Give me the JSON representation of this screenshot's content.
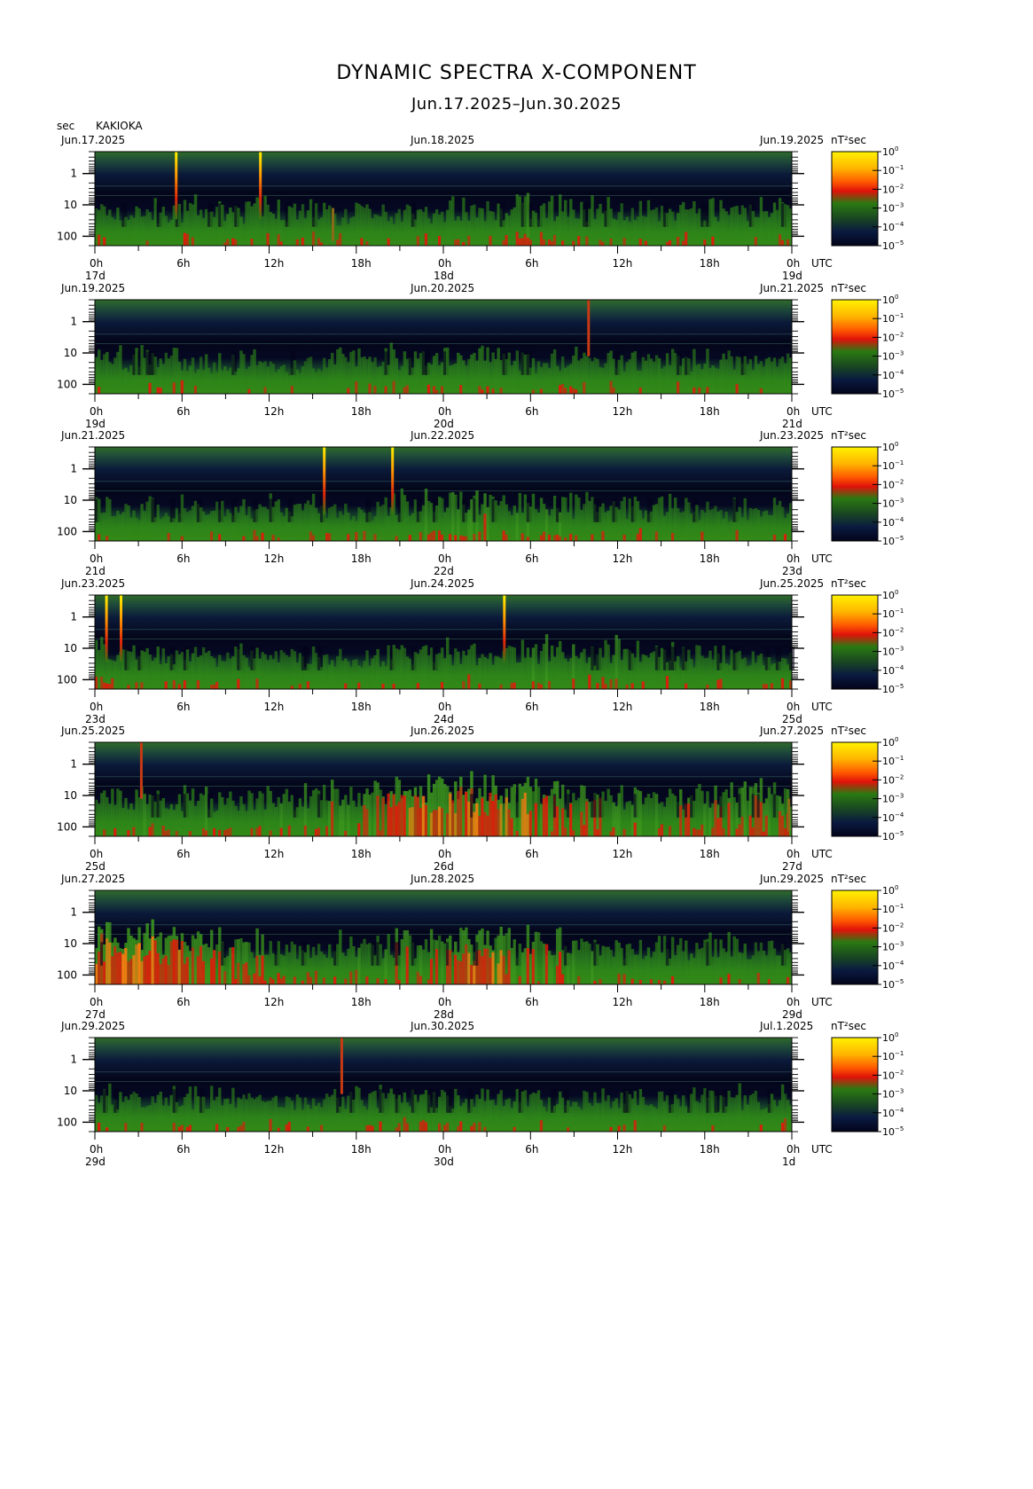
{
  "title": "DYNAMIC SPECTRA X-COMPONENT",
  "subtitle": "Jun.17.2025–Jun.30.2025",
  "y_unit": "sec",
  "station": "KAKIOKA",
  "colorbar_unit": "nT²sec",
  "time_zone": "UTC",
  "colors": {
    "background": "#050718",
    "low": "#0a1238",
    "mid": "#1c7a1c",
    "high": "#e01a0a",
    "peak": "#ffe400"
  },
  "chart_data": {
    "type": "heatmap",
    "title": "DYNAMIC SPECTRA X-COMPONENT",
    "subtitle": "Jun.17.2025–Jun.30.2025",
    "ylabel": "sec",
    "y_scale": "log",
    "y_ticks": [
      "1",
      "10",
      "100"
    ],
    "x_ticks": [
      "0h",
      "6h",
      "12h",
      "18h",
      "0h",
      "6h",
      "12h",
      "18h",
      "0h"
    ],
    "colorbar": {
      "label": "nT²sec",
      "scale": "log",
      "tick_mantissa": [
        "10",
        "10",
        "10",
        "10",
        "10",
        "10"
      ],
      "tick_exponents": [
        "0",
        "−1",
        "−2",
        "−3",
        "−4",
        "−5"
      ],
      "colors_top_to_bottom": [
        "#ffe000",
        "#ff8a00",
        "#e81b0a",
        "#2a7a12",
        "#0f2a4a",
        "#04051a"
      ]
    },
    "panels": [
      {
        "start_date": "Jun.17.2025",
        "mid_date": "Jun.18.2025",
        "end_date": "Jun.19.2025",
        "day_labels": [
          "17d",
          "18d",
          "19d"
        ],
        "activity": [
          0.45,
          0.5,
          0.55,
          0.5,
          0.4,
          0.45,
          0.5,
          0.6,
          0.55,
          0.45,
          0.5,
          0.55
        ],
        "spikes": [
          {
            "hour": 5.6,
            "strength": "strong"
          },
          {
            "hour": 11.4,
            "strength": "strong"
          },
          {
            "hour": 16.4,
            "strength": "weak"
          }
        ]
      },
      {
        "start_date": "Jun.19.2025",
        "mid_date": "Jun.20.2025",
        "end_date": "Jun.21.2025",
        "day_labels": [
          "19d",
          "20d",
          "21d"
        ],
        "activity": [
          0.5,
          0.45,
          0.4,
          0.3,
          0.45,
          0.5,
          0.55,
          0.45,
          0.45,
          0.5,
          0.45,
          0.4
        ],
        "spikes": [
          {
            "hour": 34.0,
            "strength": "medium"
          }
        ]
      },
      {
        "start_date": "Jun.21.2025",
        "mid_date": "Jun.22.2025",
        "end_date": "Jun.23.2025",
        "day_labels": [
          "21d",
          "22d",
          "23d"
        ],
        "activity": [
          0.45,
          0.4,
          0.4,
          0.45,
          0.35,
          0.6,
          0.65,
          0.6,
          0.5,
          0.45,
          0.35,
          0.4
        ],
        "spikes": [
          {
            "hour": 15.8,
            "strength": "strong"
          },
          {
            "hour": 20.5,
            "strength": "strong"
          }
        ]
      },
      {
        "start_date": "Jun.23.2025",
        "mid_date": "Jun.24.2025",
        "end_date": "Jun.25.2025",
        "day_labels": [
          "23d",
          "24d",
          "25d"
        ],
        "activity": [
          0.55,
          0.5,
          0.45,
          0.35,
          0.45,
          0.5,
          0.55,
          0.6,
          0.6,
          0.55,
          0.45,
          0.4
        ],
        "spikes": [
          {
            "hour": 0.8,
            "strength": "strong"
          },
          {
            "hour": 1.8,
            "strength": "strong"
          },
          {
            "hour": 28.2,
            "strength": "strong"
          }
        ]
      },
      {
        "start_date": "Jun.25.2025",
        "mid_date": "Jun.26.2025",
        "end_date": "Jun.27.2025",
        "day_labels": [
          "25d",
          "26d",
          "27d"
        ],
        "activity": [
          0.6,
          0.6,
          0.55,
          0.6,
          0.7,
          0.9,
          0.95,
          0.8,
          0.7,
          0.65,
          0.7,
          0.75
        ],
        "spikes": [
          {
            "hour": 3.2,
            "strength": "medium"
          },
          {
            "hour": 47.8,
            "strength": "weak"
          }
        ]
      },
      {
        "start_date": "Jun.27.2025",
        "mid_date": "Jun.28.2025",
        "end_date": "Jun.29.2025",
        "day_labels": [
          "27d",
          "28d",
          "29d"
        ],
        "activity": [
          0.95,
          0.85,
          0.7,
          0.55,
          0.6,
          0.7,
          0.8,
          0.75,
          0.6,
          0.55,
          0.55,
          0.5
        ],
        "spikes": []
      },
      {
        "start_date": "Jun.29.2025",
        "mid_date": "Jun.30.2025",
        "end_date": "Jul.1.2025",
        "day_labels": [
          "29d",
          "30d",
          "1d"
        ],
        "activity": [
          0.45,
          0.5,
          0.45,
          0.4,
          0.45,
          0.5,
          0.5,
          0.45,
          0.4,
          0.45,
          0.4,
          0.45
        ],
        "spikes": [
          {
            "hour": 17.0,
            "strength": "medium"
          }
        ]
      }
    ]
  }
}
